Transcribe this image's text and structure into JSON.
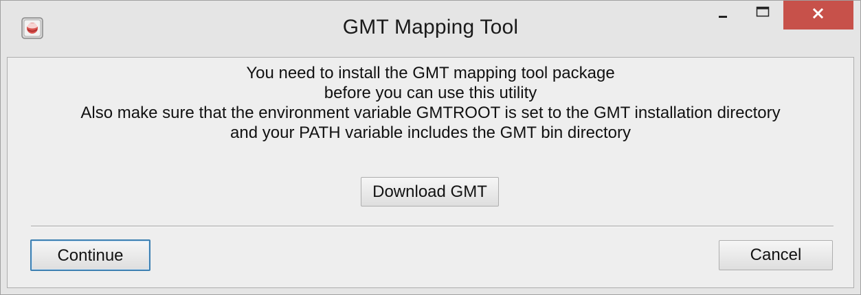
{
  "window": {
    "title": "GMT Mapping Tool",
    "app_icon": "java-app-icon",
    "controls": {
      "minimize_icon": "minimize-icon",
      "maximize_icon": "maximize-icon",
      "close_icon": "close-icon",
      "close_color": "#c7514a"
    }
  },
  "message": {
    "line1": "You need to install the GMT mapping tool package",
    "line2": "before you can use this utility",
    "line3": "Also make sure that the environment variable GMTROOT is set to the GMT installation directory",
    "line4": "and your PATH variable includes the GMT bin directory"
  },
  "buttons": {
    "download_label": "Download GMT",
    "continue_label": "Continue",
    "cancel_label": "Cancel"
  },
  "colors": {
    "default_button_border": "#3c7fb1"
  }
}
